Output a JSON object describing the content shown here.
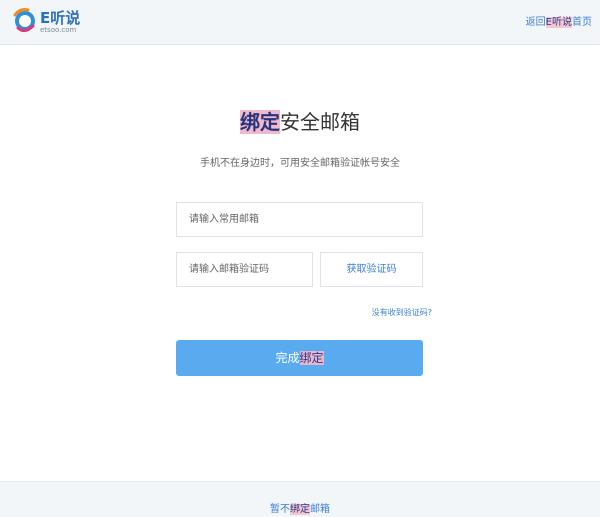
{
  "header": {
    "logo_name": "E听说",
    "logo_domain": "etsoo.com",
    "back_prefix": "返回",
    "back_highlight": "E听说",
    "back_suffix": "首页"
  },
  "main": {
    "title_highlight": "绑定",
    "title_rest": "安全邮箱",
    "subtitle": "手机不在身边时，可用安全邮箱验证帐号安全",
    "email_placeholder": "请输入常用邮箱",
    "code_placeholder": "请输入邮箱验证码",
    "get_code_label": "获取验证码",
    "no_code_link": "没有收到验证码?",
    "submit_prefix": "完成",
    "submit_highlight": "绑定"
  },
  "footer": {
    "skip_prefix": "暂不",
    "skip_highlight": "绑定",
    "skip_suffix": "邮箱"
  },
  "colors": {
    "accent": "#5aaaf0",
    "link": "#3b7fd6"
  }
}
